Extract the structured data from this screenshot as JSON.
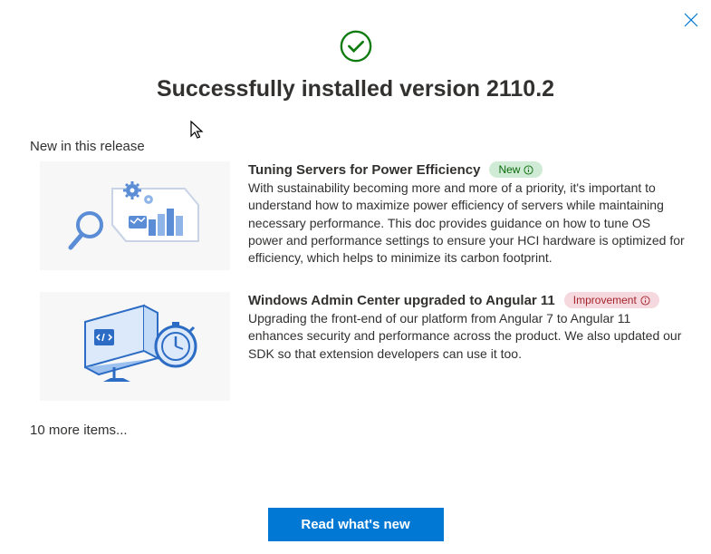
{
  "title": "Successfully installed version 2110.2",
  "section_label": "New in this release",
  "items": [
    {
      "title": "Tuning Servers for Power Efficiency",
      "badge": "New",
      "badge_type": "new",
      "description": "With sustainability becoming more and more of a priority, it's important to understand how to maximize power efficiency of servers while maintaining necessary performance. This doc provides guidance on how to tune OS power and performance settings to ensure your HCI hardware is optimized for efficiency, which helps to minimize its carbon footprint."
    },
    {
      "title": "Windows Admin Center upgraded to Angular 11",
      "badge": "Improvement",
      "badge_type": "improvement",
      "description": "Upgrading the front-end of our platform from Angular 7 to Angular 11 enhances security and performance across the product. We also updated our SDK so that extension developers can use it too."
    }
  ],
  "more_items": "10 more items...",
  "button": "Read what's new"
}
